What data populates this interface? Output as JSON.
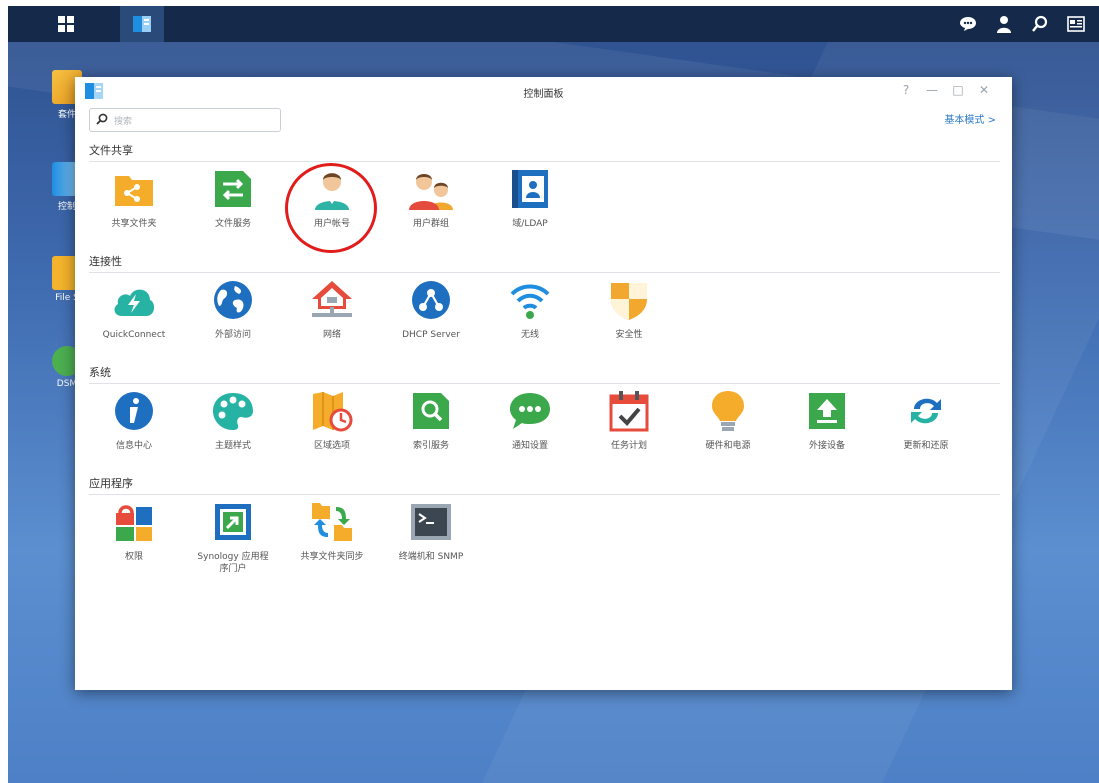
{
  "window": {
    "title": "控制面板",
    "search_placeholder": "搜索",
    "mode_link": "基本模式 >"
  },
  "desktop_icons": [
    {
      "label": "套件"
    },
    {
      "label": "控制"
    },
    {
      "label": "File S"
    },
    {
      "label": "DSM"
    }
  ],
  "sections": [
    {
      "title": "文件共享",
      "items": [
        {
          "label": "共享文件夹",
          "icon": "shared-folder-icon"
        },
        {
          "label": "文件服务",
          "icon": "file-services-icon"
        },
        {
          "label": "用户帐号",
          "icon": "user-account-icon"
        },
        {
          "label": "用户群组",
          "icon": "user-group-icon"
        },
        {
          "label": "域/LDAP",
          "icon": "domain-ldap-icon"
        }
      ]
    },
    {
      "title": "连接性",
      "items": [
        {
          "label": "QuickConnect",
          "icon": "quickconnect-icon"
        },
        {
          "label": "外部访问",
          "icon": "external-access-icon"
        },
        {
          "label": "网络",
          "icon": "network-icon"
        },
        {
          "label": "DHCP Server",
          "icon": "dhcp-server-icon"
        },
        {
          "label": "无线",
          "icon": "wireless-icon"
        },
        {
          "label": "安全性",
          "icon": "security-shield-icon"
        }
      ]
    },
    {
      "title": "系统",
      "items": [
        {
          "label": "信息中心",
          "icon": "info-center-icon"
        },
        {
          "label": "主题样式",
          "icon": "theme-palette-icon"
        },
        {
          "label": "区域选项",
          "icon": "regional-options-icon"
        },
        {
          "label": "索引服务",
          "icon": "indexing-service-icon"
        },
        {
          "label": "通知设置",
          "icon": "notification-icon"
        },
        {
          "label": "任务计划",
          "icon": "task-scheduler-icon"
        },
        {
          "label": "硬件和电源",
          "icon": "hardware-power-icon"
        },
        {
          "label": "外接设备",
          "icon": "external-devices-icon"
        },
        {
          "label": "更新和还原",
          "icon": "update-restore-icon"
        }
      ]
    },
    {
      "title": "应用程序",
      "items": [
        {
          "label": "权限",
          "icon": "privileges-icon"
        },
        {
          "label": "Synology 应用程序门户",
          "icon": "app-portal-icon"
        },
        {
          "label": "共享文件夹同步",
          "icon": "shared-folder-sync-icon"
        },
        {
          "label": "终端机和 SNMP",
          "icon": "terminal-snmp-icon"
        }
      ]
    }
  ],
  "colors": {
    "desktop_top": "#2d4f8c",
    "taskbar": "#15294a",
    "highlight_circle": "#e21b1b",
    "link": "#2c79c8"
  }
}
